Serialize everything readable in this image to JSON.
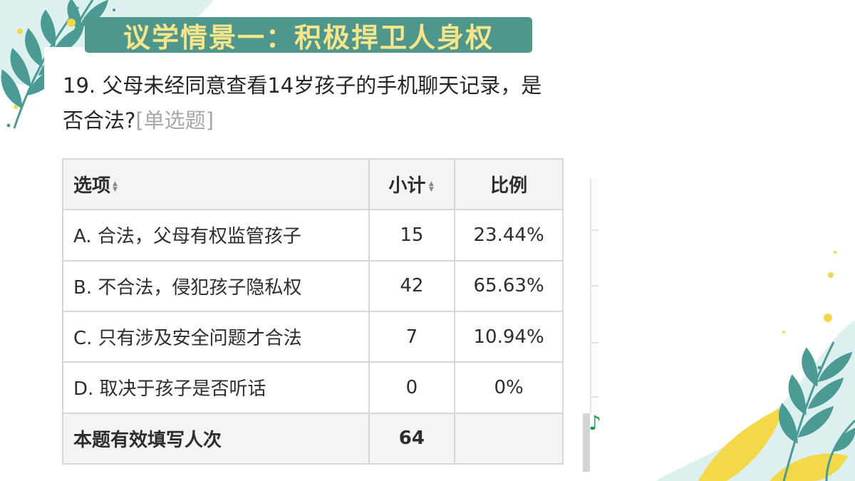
{
  "slide": {
    "title": "议学情景一：积极捍卫人身权"
  },
  "question": {
    "text": "19. 父母未经同意查看14岁孩子的手机聊天记录，是否合法?",
    "type_tag": "[单选题]"
  },
  "table": {
    "headers": {
      "option": "选项",
      "count": "小计",
      "ratio": "比例"
    },
    "rows": [
      {
        "option": "A. 合法，父母有权监管孩子",
        "count": "15",
        "ratio": "23.44%"
      },
      {
        "option": "B. 不合法，侵犯孩子隐私权",
        "count": "42",
        "ratio": "65.63%"
      },
      {
        "option": "C. 只有涉及安全问题才合法",
        "count": "7",
        "ratio": "10.94%"
      },
      {
        "option": "D. 取决于孩子是否听话",
        "count": "0",
        "ratio": "0%"
      }
    ],
    "total": {
      "label": "本题有效填写人次",
      "count": "64",
      "ratio": ""
    }
  },
  "icons": {
    "sort": "sort-icon",
    "music": "music-note-icon"
  },
  "colors": {
    "banner_bg": "#4f978c",
    "banner_text": "#f6e58a",
    "table_header_bg": "#f4f4f4",
    "table_border": "#d7d7d7",
    "leaf_teal": "#4b9a93",
    "leaf_yellow": "#f3d94a",
    "music_green": "#1a9a48"
  }
}
